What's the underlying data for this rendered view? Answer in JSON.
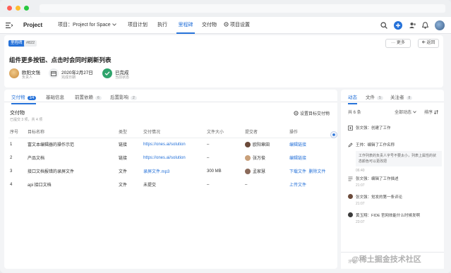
{
  "app": {
    "title": "Project"
  },
  "topnav": {
    "project_label": "项目：Project for Space",
    "tabs": [
      "项目计划",
      "执行",
      "里程碑",
      "交付物",
      "项目设置"
    ],
    "active_tab": "里程碑"
  },
  "milestone": {
    "tag": "里程碑",
    "id": "#822",
    "title": "组件更多按钮、点击时会同时刷新列表",
    "more_label": "··· 更多",
    "back_label": "返回",
    "owner_name": "欧阳文强",
    "owner_role": "负责人",
    "date_value": "2020年2月27日",
    "date_label": "完成日期",
    "status_value": "已完成",
    "status_label": "当前状态"
  },
  "tabs": [
    {
      "label": "交付物",
      "count": "3/4"
    },
    {
      "label": "基础信息",
      "count": ""
    },
    {
      "label": "前置依赖",
      "count": "6"
    },
    {
      "label": "后置影响",
      "count": "2"
    }
  ],
  "deliverables": {
    "title": "交付物",
    "subtitle": "已提交 3 项，共 4 项",
    "settings_label": "设置目标交付物",
    "columns": [
      "序号",
      "目标名称",
      "类型",
      "交付情况",
      "文件大小",
      "提交者",
      "操作"
    ],
    "rows": [
      {
        "no": "1",
        "name": "富文本编辑器的操作示范",
        "type": "链接",
        "delivery": "https://ones.ai/solution",
        "size": "–",
        "submitter": "欧阳章田",
        "actions": [
          "编辑链接"
        ]
      },
      {
        "no": "2",
        "name": "产品文档",
        "type": "链接",
        "delivery": "https://ones.ai/solution",
        "size": "–",
        "submitter": "张万俊",
        "actions": [
          "编辑链接"
        ]
      },
      {
        "no": "3",
        "name": "接口文档报错的录屏文件",
        "type": "文件",
        "delivery": "录屏文件.mp3",
        "size": "300 MB",
        "submitter": "孟家慧",
        "actions": [
          "下载文件",
          "删除文件"
        ]
      },
      {
        "no": "4",
        "name": "api 接口文档",
        "type": "文件",
        "delivery": "未提交",
        "size": "–",
        "submitter": "–",
        "actions": [
          "上传文件"
        ]
      }
    ]
  },
  "feed": {
    "tabs": [
      {
        "label": "动态",
        "count": ""
      },
      {
        "label": "文件",
        "count": "5"
      },
      {
        "label": "关注者",
        "count": "8"
      }
    ],
    "total": "共 6 条",
    "filter": "全部动态",
    "sort": "排序",
    "items": [
      {
        "who": "张文强：创建了工作",
        "detail": "",
        "time": ""
      },
      {
        "who": "王帅：编辑了工作名称",
        "detail": "工作列表的负责人字号不要太小，列表上属性的状态颜色可以更改把",
        "time": "06:40"
      },
      {
        "who": "张文强：编辑了工作描述",
        "detail": "",
        "time": "21:07"
      },
      {
        "who": "张文强：觉发的第一条评论",
        "detail": "",
        "time": "21:07"
      },
      {
        "who": "黄玉翔：FIDE 官网效能什么时候发啊",
        "detail": "",
        "time": "23:07"
      }
    ],
    "comment_placeholder": "评论"
  },
  "watermark": "@稀土掘金技术社区",
  "colors": {
    "accent": "#2672d9",
    "success": "#2fa46c"
  }
}
